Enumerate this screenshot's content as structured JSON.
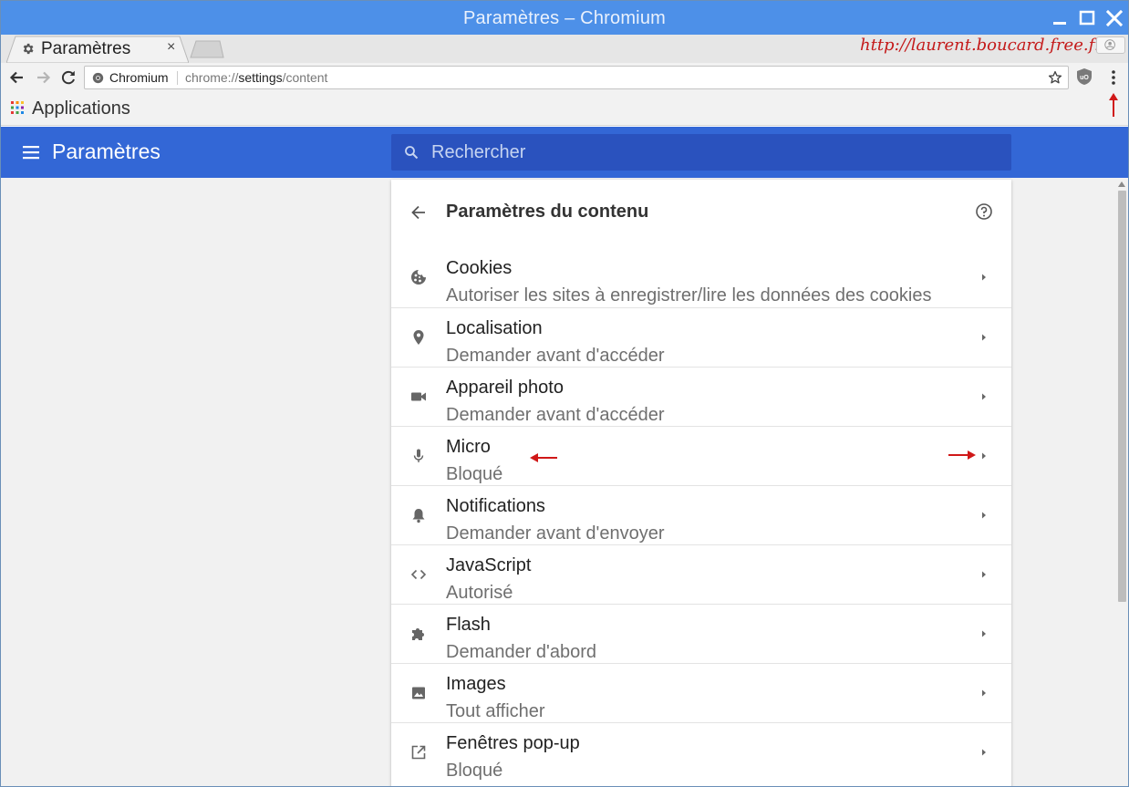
{
  "window": {
    "title": "Paramètres – Chromium"
  },
  "tab": {
    "title": "Paramètres",
    "close": "×"
  },
  "watermark": "http://laurent.boucard.free.fr",
  "omnibox": {
    "site_chip": "Chromium",
    "url_scheme": "chrome://",
    "url_host": "settings",
    "url_path": "/content"
  },
  "bookmarks": {
    "apps_label": "Applications"
  },
  "settings_header": {
    "title": "Paramètres",
    "search_placeholder": "Rechercher"
  },
  "card": {
    "title": "Paramètres du contenu",
    "rows": [
      {
        "label": "Cookies",
        "sub": "Autoriser les sites à enregistrer/lire les données des cookies",
        "icon": "cookie-icon"
      },
      {
        "label": "Localisation",
        "sub": "Demander avant d'accéder",
        "icon": "location-pin-icon"
      },
      {
        "label": "Appareil photo",
        "sub": "Demander avant d'accéder",
        "icon": "camera-icon"
      },
      {
        "label": "Micro",
        "sub": "Bloqué",
        "icon": "microphone-icon"
      },
      {
        "label": "Notifications",
        "sub": "Demander avant d'envoyer",
        "icon": "bell-icon"
      },
      {
        "label": "JavaScript",
        "sub": "Autorisé",
        "icon": "code-icon"
      },
      {
        "label": "Flash",
        "sub": "Demander d'abord",
        "icon": "puzzle-piece-icon"
      },
      {
        "label": "Images",
        "sub": "Tout afficher",
        "icon": "image-icon"
      },
      {
        "label": "Fenêtres pop-up",
        "sub": "Bloqué",
        "icon": "open-in-new-icon"
      }
    ]
  },
  "colors": {
    "titlebar": "#4d90e8",
    "settings_header": "#3367d6",
    "search_box": "#2a52be",
    "annotation_red": "#d01818"
  }
}
